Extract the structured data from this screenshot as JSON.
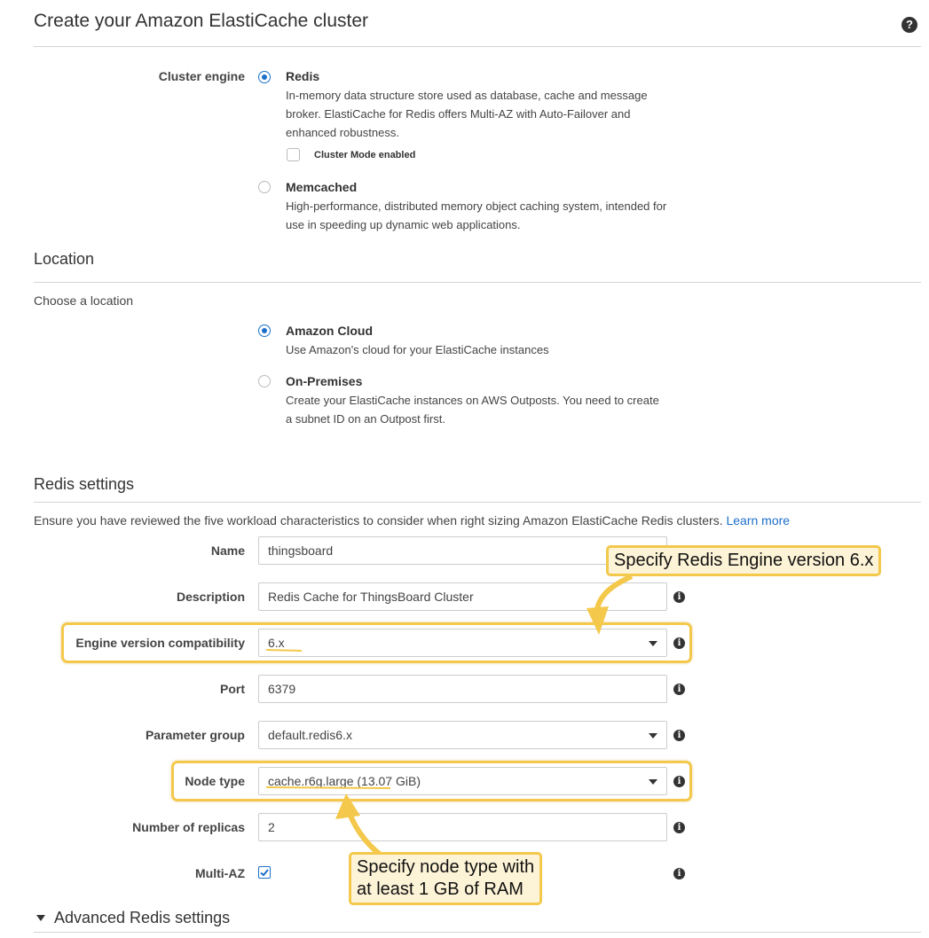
{
  "page_title": "Create your Amazon ElastiCache cluster",
  "help_icon": "question-circle-icon",
  "cluster_engine": {
    "label": "Cluster engine",
    "redis": {
      "title": "Redis",
      "desc": "In-memory data structure store used as database, cache and message broker. ElastiCache for Redis offers Multi-AZ with Auto-Failover and enhanced robustness.",
      "selected": true,
      "cluster_mode_label": "Cluster Mode enabled",
      "cluster_mode_checked": false
    },
    "memcached": {
      "title": "Memcached",
      "desc": "High-performance, distributed memory object caching system, intended for use in speeding up dynamic web applications.",
      "selected": false
    }
  },
  "location": {
    "heading": "Location",
    "subheading": "Choose a location",
    "amazon_cloud": {
      "title": "Amazon Cloud",
      "desc": "Use Amazon's cloud for your ElastiCache instances",
      "selected": true
    },
    "on_premises": {
      "title": "On-Premises",
      "desc": "Create your ElastiCache instances on AWS Outposts. You need to create a subnet ID on an Outpost first.",
      "selected": false
    }
  },
  "redis_settings": {
    "heading": "Redis settings",
    "intro": "Ensure you have reviewed the five workload characteristics to consider when right sizing Amazon ElastiCache Redis clusters.",
    "learn_more": "Learn more",
    "name": {
      "label": "Name",
      "value": "thingsboard"
    },
    "description": {
      "label": "Description",
      "value": "Redis Cache for ThingsBoard Cluster"
    },
    "engine_version": {
      "label": "Engine version compatibility",
      "value": "6.x"
    },
    "port": {
      "label": "Port",
      "value": "6379"
    },
    "parameter_group": {
      "label": "Parameter group",
      "value": "default.redis6.x"
    },
    "node_type": {
      "label": "Node type",
      "value": "cache.r6g.large (13.07 GiB)"
    },
    "replicas": {
      "label": "Number of replicas",
      "value": "2"
    },
    "multi_az": {
      "label": "Multi-AZ",
      "checked": true
    }
  },
  "advanced": {
    "label": "Advanced Redis settings"
  },
  "annotations": {
    "engine_callout": "Specify Redis Engine version 6.x",
    "node_callout_line1": "Specify node type with",
    "node_callout_line2": "at least 1 GB of RAM"
  },
  "colors": {
    "accent": "#1d6fc9",
    "highlight": "#f3c84b",
    "callout_bg": "#fdf3d6"
  }
}
